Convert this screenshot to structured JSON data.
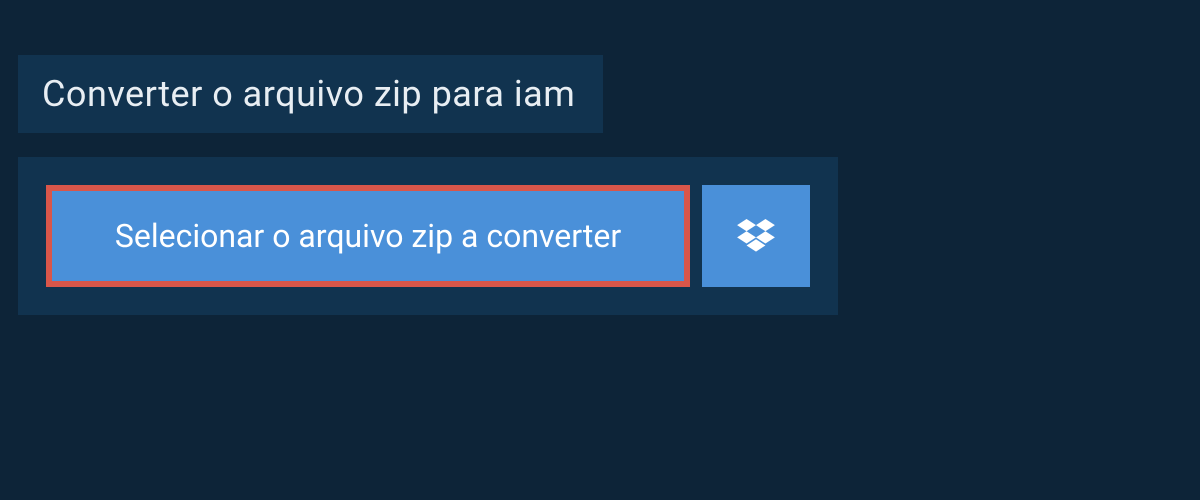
{
  "header": {
    "title": "Converter o arquivo zip para iam"
  },
  "upload": {
    "select_label": "Selecionar o arquivo zip a converter",
    "dropbox_icon_name": "dropbox-icon"
  },
  "colors": {
    "page_bg": "#0d2438",
    "panel_bg": "#11334f",
    "button_bg": "#4a90d9",
    "highlight_border": "#d9564a",
    "text_light": "#e8eef3",
    "text_white": "#ffffff"
  }
}
